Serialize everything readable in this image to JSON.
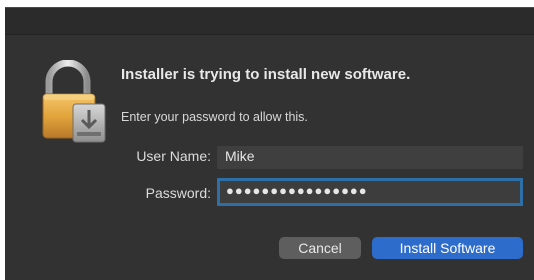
{
  "dialog": {
    "title": "Installer is trying to install new software.",
    "subtitle": "Enter your password to allow this.",
    "icon": "lock-with-installer-icon"
  },
  "form": {
    "username_label": "User Name:",
    "username_value": "Mike",
    "password_label": "Password:",
    "password_value": "●●●●●●●●●●●●●●●●"
  },
  "buttons": {
    "cancel": "Cancel",
    "install": "Install Software"
  },
  "colors": {
    "background": "#323232",
    "accent": "#2e6ccb",
    "focus_ring": "#2f6fa7",
    "lock_gold": "#e3a53c"
  }
}
